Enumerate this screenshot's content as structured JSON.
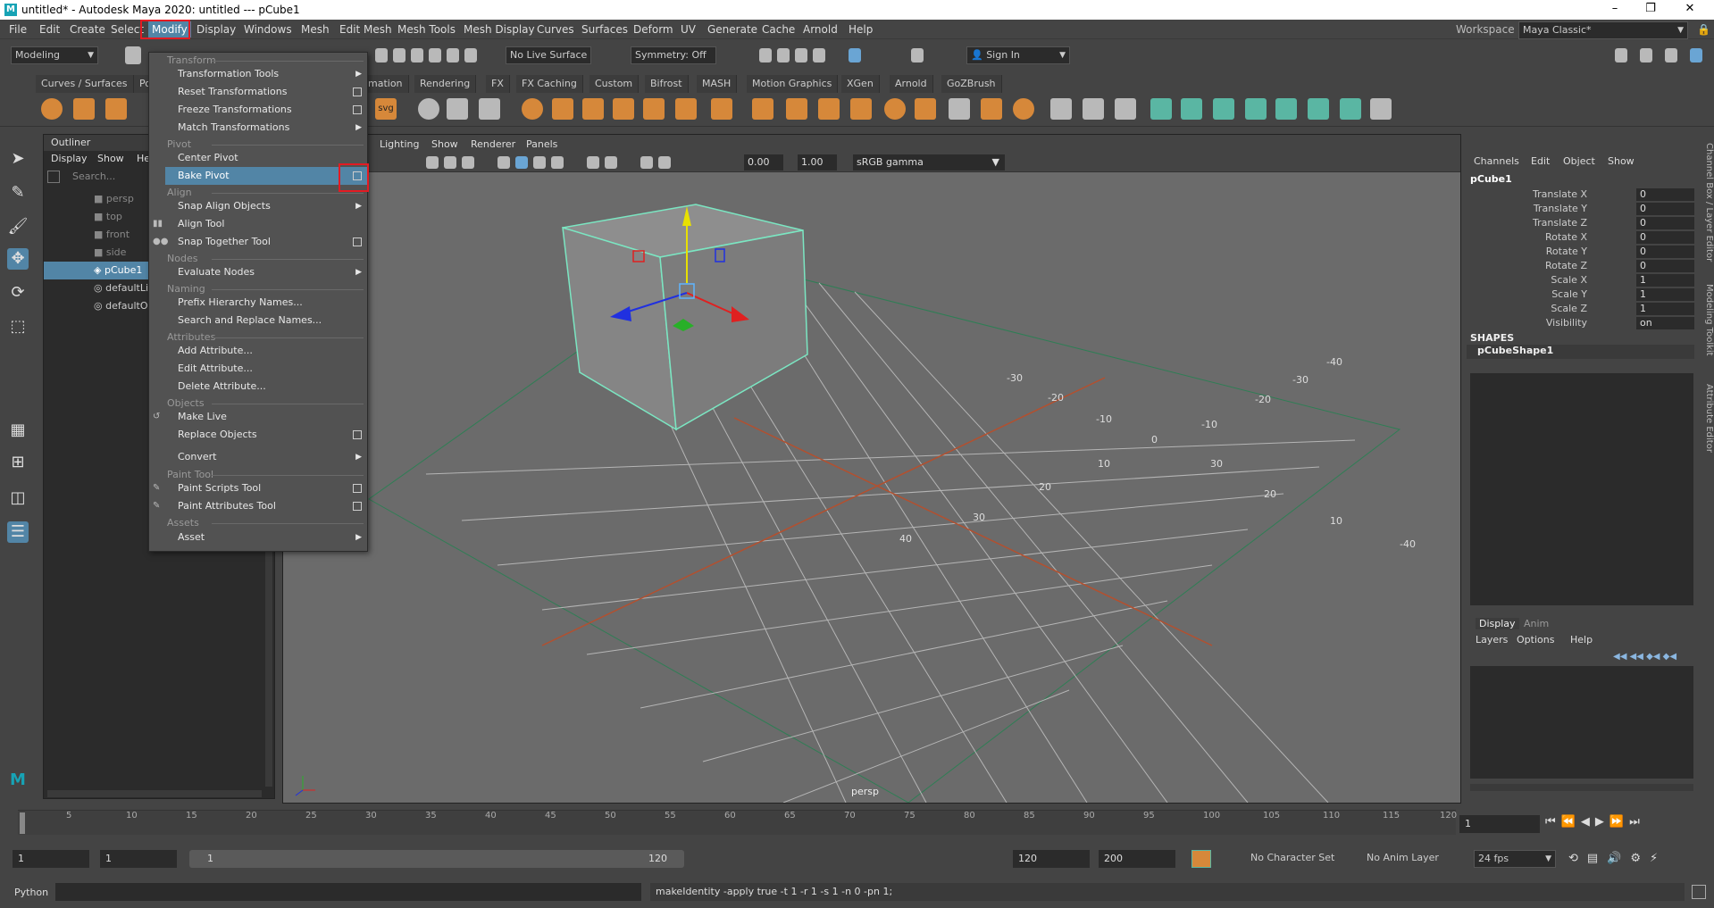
{
  "window": {
    "title": "untitled* - Autodesk Maya 2020: untitled   ---   pCube1"
  },
  "menubar": [
    "File",
    "Edit",
    "Create",
    "Select",
    "Modify",
    "Display",
    "Windows",
    "Mesh",
    "Edit Mesh",
    "Mesh Tools",
    "Mesh Display",
    "Curves",
    "Surfaces",
    "Deform",
    "UV",
    "Generate",
    "Cache",
    "Arnold",
    "Help"
  ],
  "workspace": {
    "label": "Workspace :",
    "value": "Maya Classic*"
  },
  "toolbar": {
    "mode": "Modeling",
    "live_surface": "No Live Surface",
    "symmetry": "Symmetry: Off",
    "sign_in": "Sign In"
  },
  "shelf_tabs": [
    "Curves / Surfaces",
    "Polygons",
    "mation",
    "Rendering",
    "FX",
    "FX Caching",
    "Custom",
    "Bifrost",
    "MASH",
    "Motion Graphics",
    "XGen",
    "Arnold",
    "GoZBrush"
  ],
  "outliner": {
    "title": "Outliner",
    "menu": [
      "Display",
      "Show",
      "Help"
    ],
    "search_placeholder": "Search...",
    "items": [
      "persp",
      "top",
      "front",
      "side",
      "pCube1",
      "defaultLightSet",
      "defaultObjectSet"
    ]
  },
  "viewport": {
    "menu": [
      "Lighting",
      "Show",
      "Renderer",
      "Panels"
    ],
    "exposure": "0.00",
    "gamma": "1.00",
    "color_space": "sRGB gamma",
    "camera_label": "persp",
    "grid_labels": [
      "-40",
      "-30",
      "-20",
      "-10",
      "0",
      "10",
      "20",
      "30",
      "40",
      "30",
      "20",
      "10",
      "-10",
      "-20",
      "-30",
      "-40"
    ]
  },
  "modify_menu": {
    "sections": [
      {
        "title": "Transform",
        "items": [
          {
            "label": "Transformation Tools",
            "sub": true
          },
          {
            "label": "Reset Transformations",
            "opt": true
          },
          {
            "label": "Freeze Transformations",
            "opt": true
          },
          {
            "label": "Match Transformations",
            "sub": true
          }
        ]
      },
      {
        "title": "Pivot",
        "items": [
          {
            "label": "Center Pivot"
          },
          {
            "label": "Bake Pivot",
            "opt": true,
            "highlight": true
          }
        ]
      },
      {
        "title": "Align",
        "items": [
          {
            "label": "Snap Align Objects",
            "sub": true
          },
          {
            "label": "Align Tool"
          },
          {
            "label": "Snap Together Tool",
            "opt": true
          }
        ]
      },
      {
        "title": "Nodes",
        "items": [
          {
            "label": "Evaluate Nodes",
            "sub": true
          }
        ]
      },
      {
        "title": "Naming",
        "items": [
          {
            "label": "Prefix Hierarchy Names..."
          },
          {
            "label": "Search and Replace Names..."
          }
        ]
      },
      {
        "title": "Attributes",
        "items": [
          {
            "label": "Add Attribute..."
          },
          {
            "label": "Edit Attribute..."
          },
          {
            "label": "Delete Attribute..."
          }
        ]
      },
      {
        "title": "Objects",
        "items": [
          {
            "label": "Make Live"
          },
          {
            "label": "Replace Objects",
            "opt": true
          },
          {
            "label": "Convert",
            "sub": true
          }
        ]
      },
      {
        "title": "Paint Tool",
        "items": [
          {
            "label": "Paint Scripts Tool",
            "opt": true
          },
          {
            "label": "Paint Attributes Tool",
            "opt": true
          }
        ]
      },
      {
        "title": "Assets",
        "items": [
          {
            "label": "Asset",
            "sub": true
          }
        ]
      }
    ]
  },
  "channel_box": {
    "menu": [
      "Channels",
      "Edit",
      "Object",
      "Show"
    ],
    "object": "pCube1",
    "attrs": [
      {
        "label": "Translate X",
        "value": "0"
      },
      {
        "label": "Translate Y",
        "value": "0"
      },
      {
        "label": "Translate Z",
        "value": "0"
      },
      {
        "label": "Rotate X",
        "value": "0"
      },
      {
        "label": "Rotate Y",
        "value": "0"
      },
      {
        "label": "Rotate Z",
        "value": "0"
      },
      {
        "label": "Scale X",
        "value": "1"
      },
      {
        "label": "Scale Y",
        "value": "1"
      },
      {
        "label": "Scale Z",
        "value": "1"
      },
      {
        "label": "Visibility",
        "value": "on"
      }
    ],
    "shapes_label": "SHAPES",
    "shape": "pCubeShape1",
    "side_tabs": [
      "Channel Box / Layer Editor",
      "Modeling Toolkit",
      "Attribute Editor"
    ]
  },
  "layer_editor": {
    "tabs": [
      "Display",
      "Anim"
    ],
    "menu": [
      "Layers",
      "Options",
      "Help"
    ]
  },
  "timeline": {
    "ticks": [
      "5",
      "10",
      "15",
      "20",
      "25",
      "30",
      "35",
      "40",
      "45",
      "50",
      "55",
      "60",
      "65",
      "70",
      "75",
      "80",
      "85",
      "90",
      "95",
      "100",
      "105",
      "110",
      "115",
      "120"
    ],
    "current_frame": "1"
  },
  "range": {
    "start": "1",
    "anim_start": "1",
    "slider_start": "1",
    "slider_end": "120",
    "end": "120",
    "anim_end": "200",
    "character_set": "No Character Set",
    "anim_layer": "No Anim Layer",
    "fps": "24 fps"
  },
  "command_line": {
    "language": "Python",
    "feedback": "makeIdentity -apply true -t 1 -r 1 -s 1 -n 0 -pn 1;"
  },
  "colors": {
    "accent": "#5285a6",
    "highlight_box": "#e31b23"
  }
}
